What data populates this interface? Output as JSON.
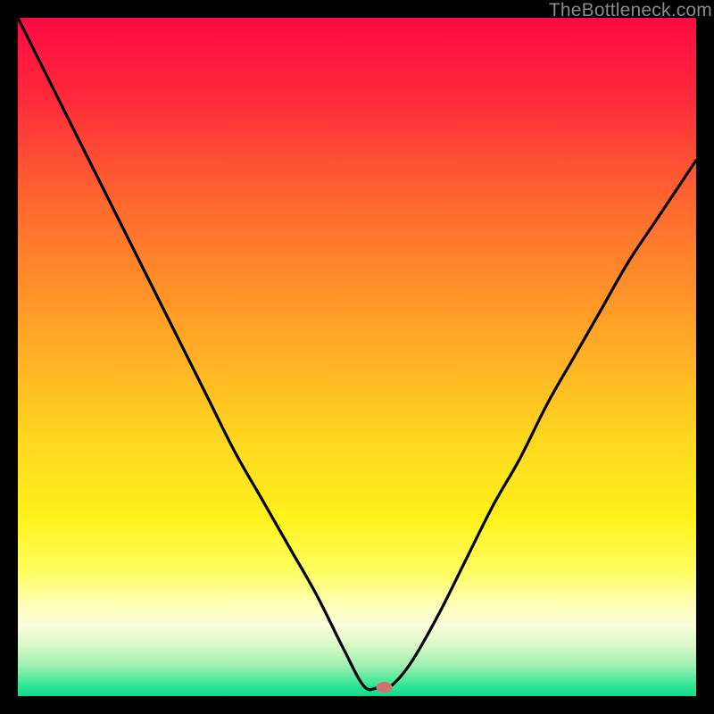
{
  "watermark": "TheBottleneck.com",
  "chart_data": {
    "type": "line",
    "title": "",
    "xlabel": "",
    "ylabel": "",
    "xlim": [
      0,
      100
    ],
    "ylim": [
      0,
      100
    ],
    "annotations": [
      {
        "text": "TheBottleneck.com",
        "position": "top-right"
      }
    ],
    "gradient_stops": [
      {
        "offset": 0.0,
        "color": "#ff0a44"
      },
      {
        "offset": 0.12,
        "color": "#ff2b3a"
      },
      {
        "offset": 0.28,
        "color": "#ff6a2f"
      },
      {
        "offset": 0.45,
        "color": "#ffa127"
      },
      {
        "offset": 0.62,
        "color": "#ffd620"
      },
      {
        "offset": 0.74,
        "color": "#fff21c"
      },
      {
        "offset": 0.82,
        "color": "#ffff66"
      },
      {
        "offset": 0.86,
        "color": "#ffffb0"
      },
      {
        "offset": 0.895,
        "color": "#fafddb"
      },
      {
        "offset": 0.925,
        "color": "#d9f8c8"
      },
      {
        "offset": 0.955,
        "color": "#9ef0b2"
      },
      {
        "offset": 0.985,
        "color": "#2fe594"
      },
      {
        "offset": 1.0,
        "color": "#12d98a"
      }
    ],
    "curve": {
      "description": "V-shaped bottleneck curve. y is mismatch % (0=bottom, 100=top). Minimum plateau around x≈51-55.",
      "x": [
        0,
        4,
        8,
        12,
        16,
        20,
        24,
        28,
        32,
        36,
        40,
        44,
        48,
        51,
        53,
        55,
        58,
        62,
        66,
        70,
        74,
        78,
        82,
        86,
        90,
        94,
        98,
        100
      ],
      "y": [
        100,
        92,
        84,
        76,
        68,
        60,
        52,
        44,
        36,
        29,
        22,
        15,
        7,
        1.5,
        1.2,
        1.5,
        5,
        12,
        20,
        28,
        35,
        43,
        50,
        57,
        64,
        70,
        76,
        79
      ]
    },
    "marker": {
      "x": 54,
      "y": 1.3,
      "color": "#cc746f",
      "rx": 9,
      "ry": 6
    }
  }
}
